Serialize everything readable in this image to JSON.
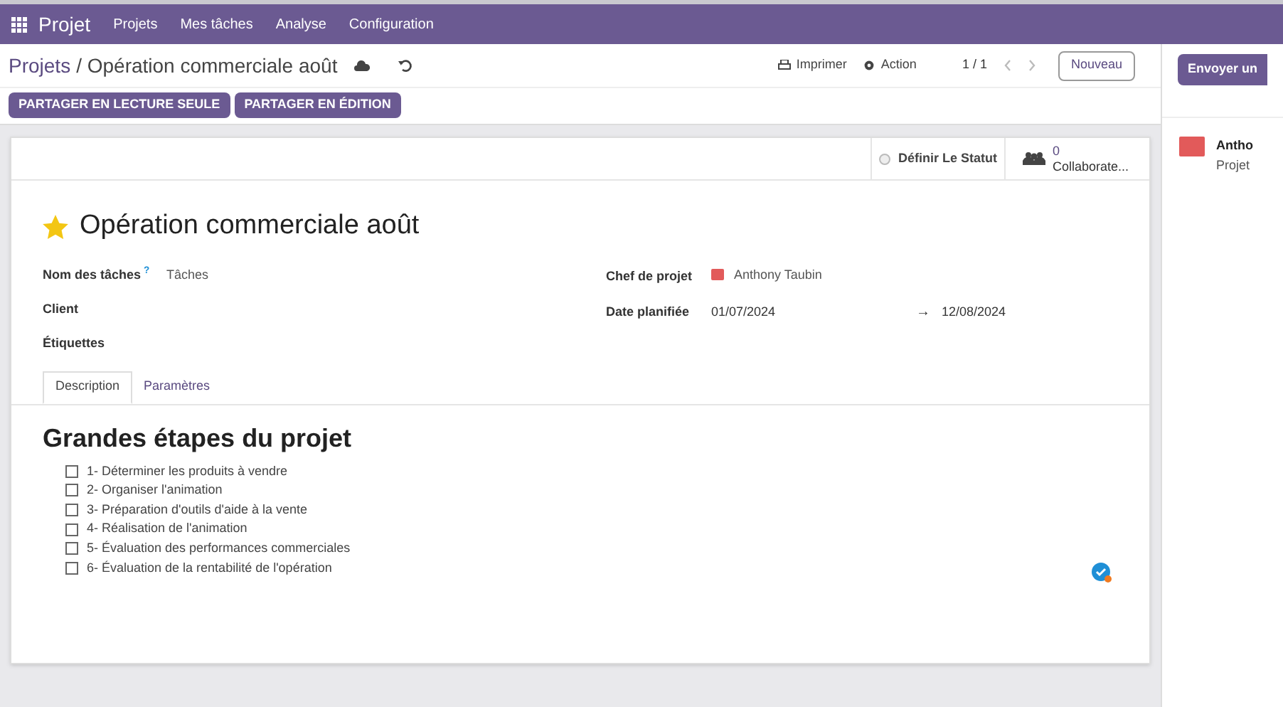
{
  "navbar": {
    "app": "Projet",
    "menu": [
      "Projets",
      "Mes tâches",
      "Analyse",
      "Configuration"
    ]
  },
  "breadcrumb": {
    "parent": "Projets",
    "separator": "/",
    "current": "Opération commerciale août"
  },
  "toolbar": {
    "print": "Imprimer",
    "action": "Action",
    "pager": "1 / 1",
    "new": "Nouveau"
  },
  "share_buttons": [
    "PARTAGER EN LECTURE SEULE",
    "PARTAGER EN ÉDITION"
  ],
  "status": {
    "label": "Définir Le Statut",
    "collaborators_count": "0",
    "collaborators_label": "Collaborate..."
  },
  "record": {
    "title": "Opération commerciale août",
    "favorite": true
  },
  "fields_left": [
    {
      "label": "Nom des tâches",
      "help": "?",
      "value": "Tâches"
    },
    {
      "label": "Client"
    },
    {
      "label": "Étiquettes"
    }
  ],
  "fields_right": [
    {
      "label": "Chef de projet",
      "value": "Anthony Taubin"
    },
    {
      "label": "Date planifiée",
      "start": "01/07/2024",
      "arrow": "→",
      "end": "12/08/2024"
    }
  ],
  "tabs": [
    {
      "label": "Description",
      "selected": true
    },
    {
      "label": "Paramètres",
      "selected": false
    }
  ],
  "description": {
    "heading": "Grandes étapes du projet",
    "checklist": [
      {
        "text": "1- Déterminer les produits à vendre",
        "checked": false
      },
      {
        "text": "2- Organiser l'animation",
        "checked": false
      },
      {
        "text": "3- Préparation d'outils d'aide à la vente",
        "checked": false
      },
      {
        "text": "4- Réalisation de l'animation",
        "checked": false
      },
      {
        "text": "5- Évaluation des performances commerciales",
        "checked": false
      },
      {
        "text": "6- Évaluation de la rentabilité de l'opération",
        "checked": false
      }
    ]
  },
  "chatter": {
    "send_button": "Envoyer un",
    "message": {
      "author": "Antho",
      "subtitle": "Projet"
    }
  }
}
